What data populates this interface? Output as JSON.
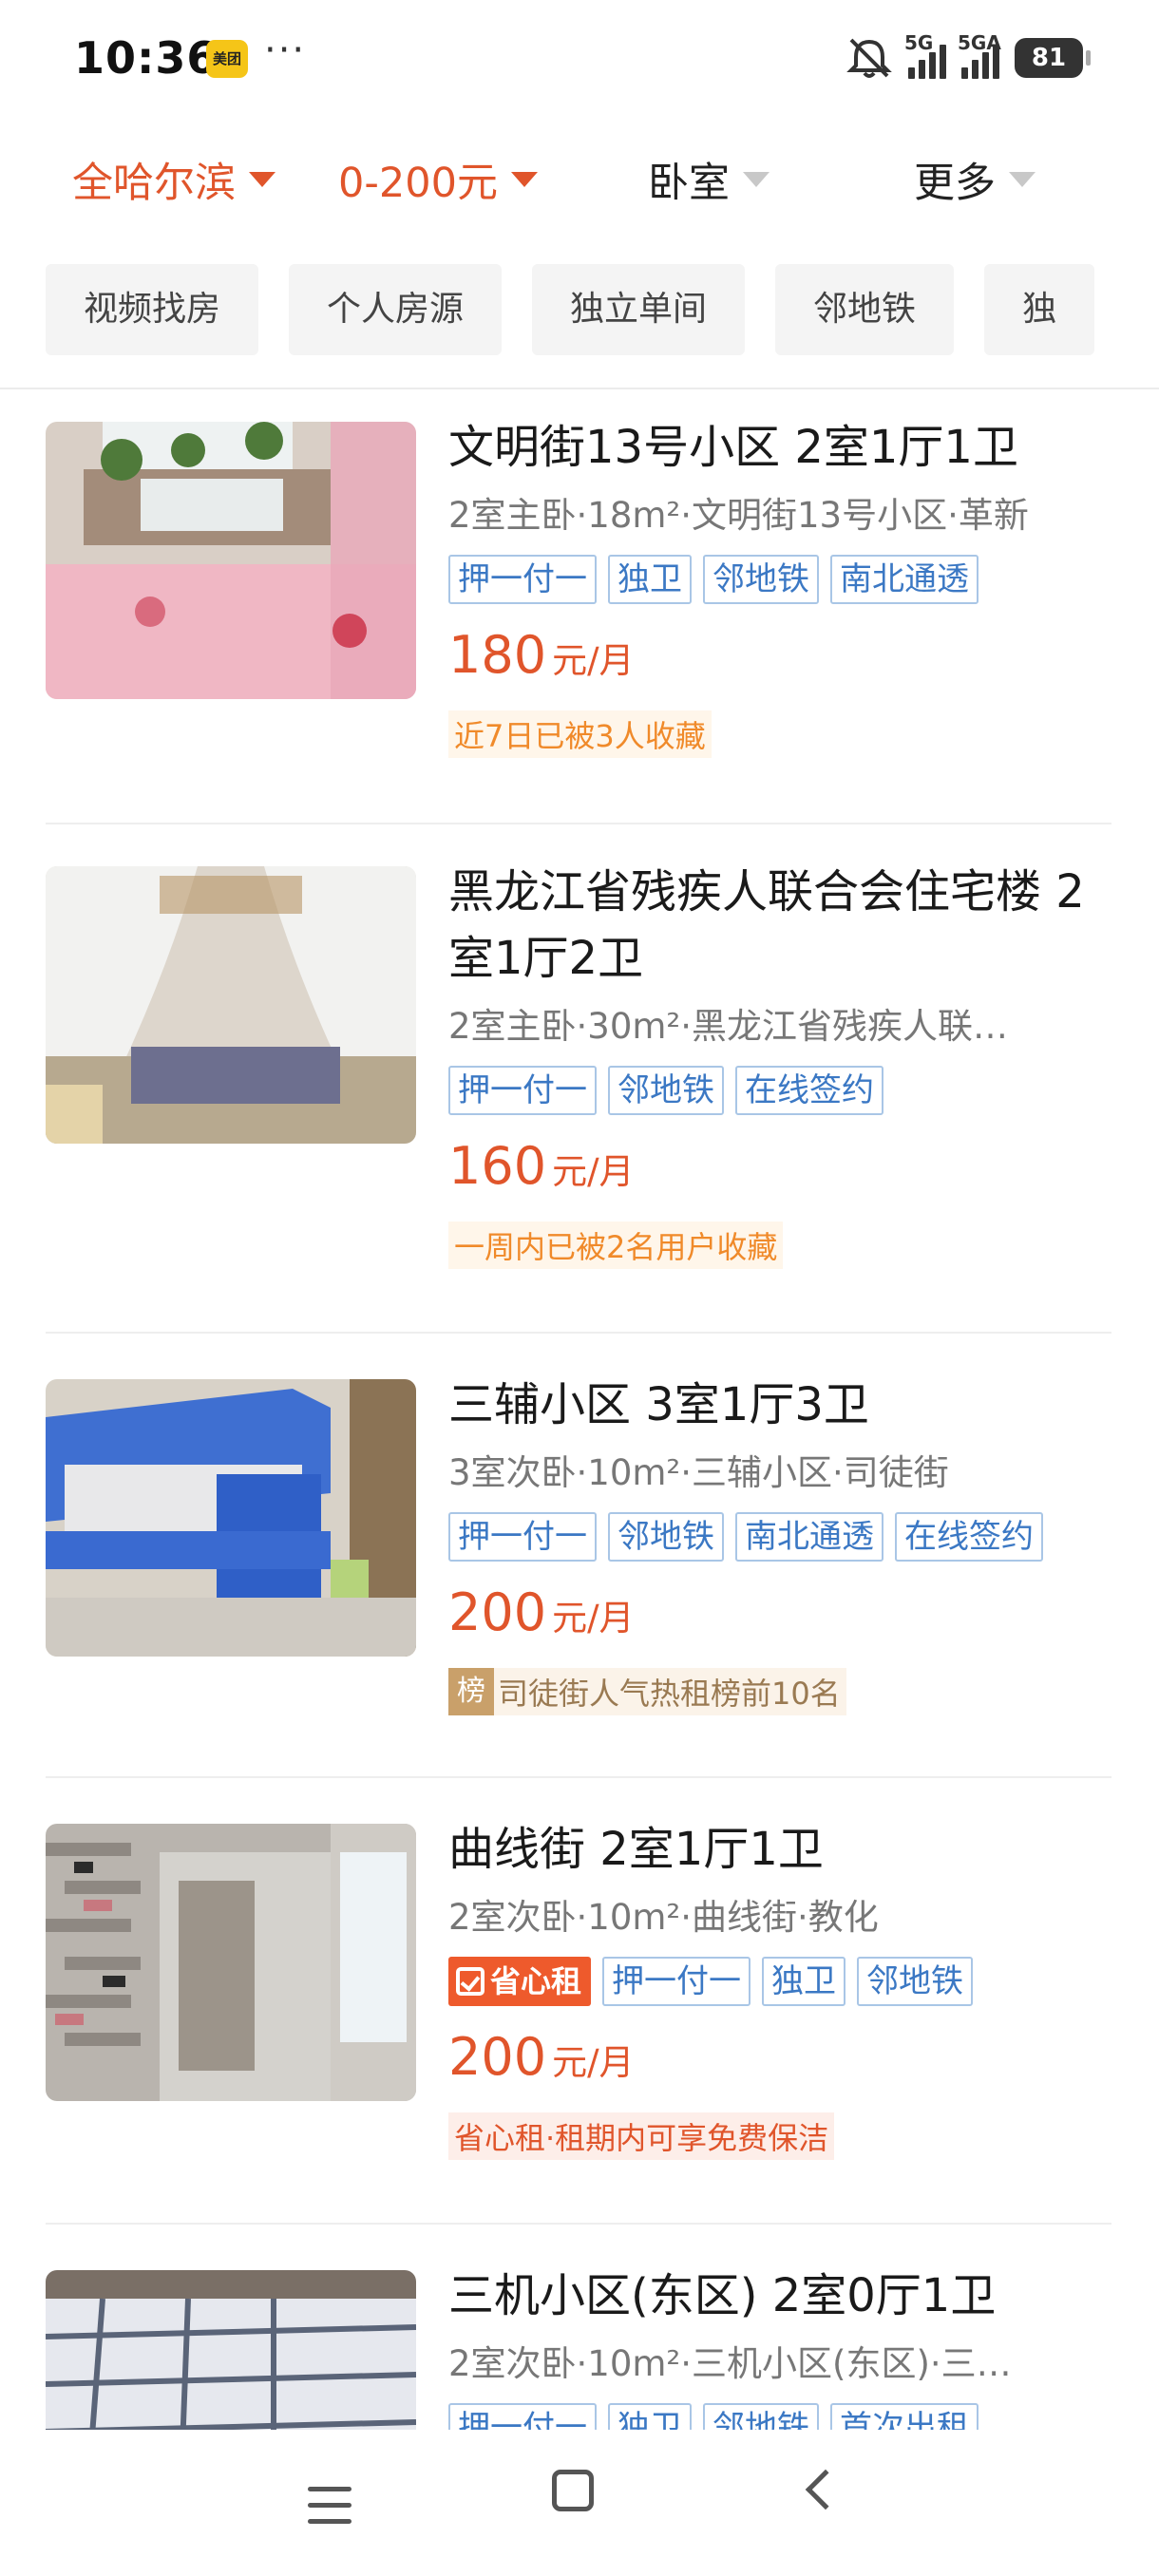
{
  "status_bar": {
    "time": "10:36",
    "app_badge": "美团",
    "more": "···",
    "icons": [
      "mute-icon",
      "signal-5g-icon",
      "signal-5ga-icon",
      "battery-icon"
    ],
    "signal_1_label": "5G",
    "signal_2_label": "5GA",
    "battery": "81"
  },
  "filters": {
    "city": "全哈尔滨",
    "price": "0-200元",
    "room": "卧室",
    "more": "更多"
  },
  "chips": [
    "视频找房",
    "个人房源",
    "独立单间",
    "邻地铁",
    "独"
  ],
  "listings": [
    {
      "title": "文明街13号小区 2室1厅1卫",
      "desc": "2室主卧·18m²·文明街13号小区·革新",
      "tags": [
        "押一付一",
        "独卫",
        "邻地铁",
        "南北通透"
      ],
      "price": "180",
      "unit": "元/月",
      "note": "近7日已被3人收藏"
    },
    {
      "title": "黑龙江省残疾人联合会住宅楼 2室1厅2卫",
      "desc": "2室主卧·30m²·黑龙江省残疾人联…",
      "tags": [
        "押一付一",
        "邻地铁",
        "在线签约"
      ],
      "price": "160",
      "unit": "元/月",
      "note": "一周内已被2名用户收藏"
    },
    {
      "title": "三辅小区 3室1厅3卫",
      "desc": "3室次卧·10m²·三辅小区·司徒街",
      "tags": [
        "押一付一",
        "邻地铁",
        "南北通透",
        "在线签约"
      ],
      "price": "200",
      "unit": "元/月",
      "rank_mark": "榜",
      "note": "司徒街人气热租榜前10名"
    },
    {
      "title": "曲线街 2室1厅1卫",
      "desc": "2室次卧·10m²·曲线街·教化",
      "brand_tag": "省心租",
      "tags": [
        "押一付一",
        "独卫",
        "邻地铁"
      ],
      "price": "200",
      "unit": "元/月",
      "note": "省心租·租期内可享免费保洁"
    },
    {
      "title": "三机小区(东区) 2室0厅1卫",
      "desc": "2室次卧·10m²·三机小区(东区)·三…",
      "tags": [
        "押一付一",
        "独卫",
        "邻地铁",
        "首次出租"
      ]
    }
  ]
}
